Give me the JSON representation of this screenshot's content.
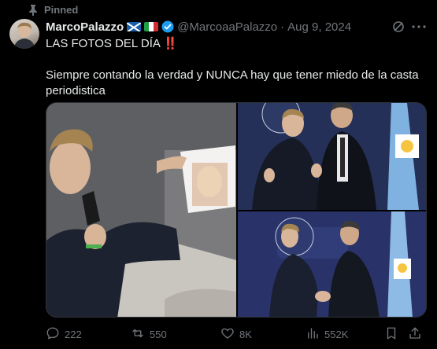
{
  "pinned": {
    "label": "Pinned"
  },
  "author": {
    "name": "MarcoPalazzo",
    "handle": "@MarcoaaPalazzo",
    "separator": "·",
    "date": "Aug 9, 2024"
  },
  "tweet": {
    "line1": "LAS FOTOS DEL DÍA ‼️",
    "line2": "Siempre contando la verdad y NUNCA hay que tener miedo de la casta periodistica"
  },
  "media": {
    "images": [
      "photo-press-conference",
      "photo-two-men-thumbs-up",
      "photo-handshake"
    ]
  },
  "actions": {
    "replies": "222",
    "reposts": "550",
    "likes": "8K",
    "views": "552K"
  },
  "colors": {
    "background": "#000000",
    "text": "#e7e9ea",
    "muted": "#71767b",
    "verified": "#1d9bf0"
  }
}
